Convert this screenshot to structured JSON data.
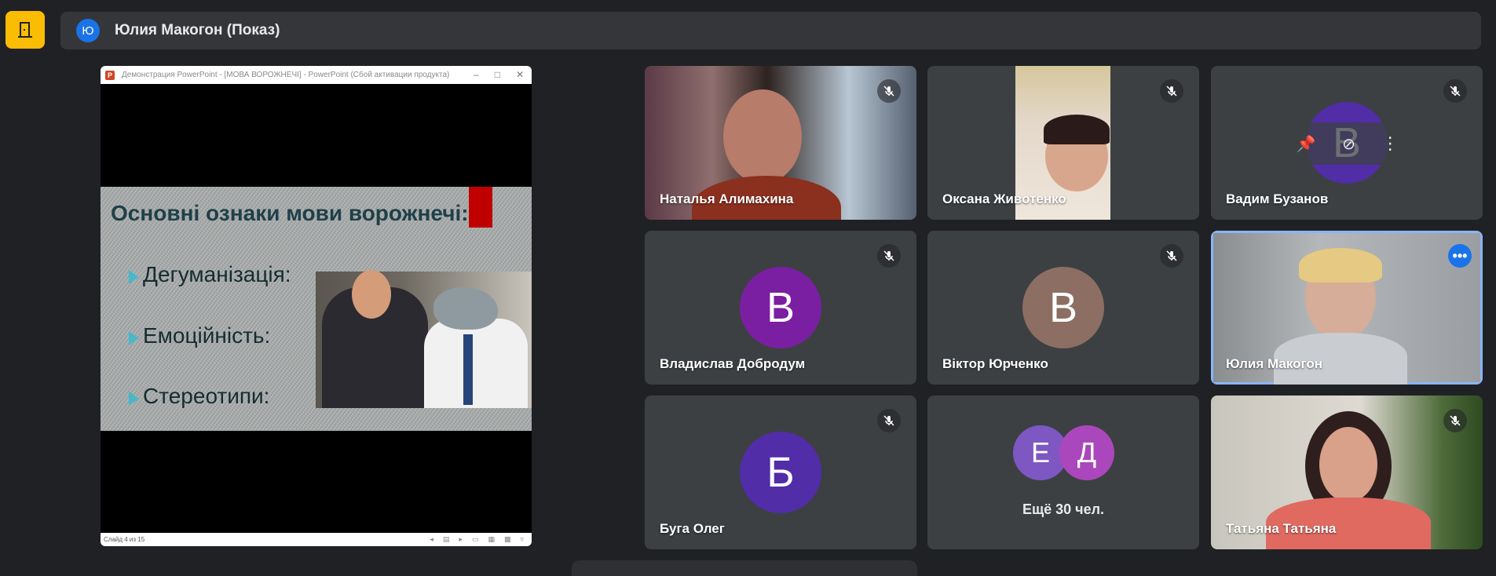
{
  "topbar": {
    "avatar_letter": "Ю",
    "title": "Юлия Макогон (Показ)"
  },
  "presentation": {
    "window_title": "Демонстрация PowerPoint - [МОВА ВОРОЖНЕЧІ] - PowerPoint (Сбой активации продукта)",
    "slide_title": "Основні ознаки мови ворожнечі:",
    "bullets": [
      "Дегуманізація:",
      "Емоційність:",
      "Стереотипи:"
    ],
    "status": "Слайд 4 из 15"
  },
  "participants": [
    {
      "name": "Наталья Алимахина",
      "type": "video",
      "muted": true
    },
    {
      "name": "Оксана Животенко",
      "type": "video",
      "muted": true
    },
    {
      "name": "Вадим Бузанов",
      "type": "avatar",
      "letter": "В",
      "muted": true
    },
    {
      "name": "Владислав Добродум",
      "type": "avatar",
      "letter": "В",
      "muted": true
    },
    {
      "name": "Віктор Юрченко",
      "type": "avatar",
      "letter": "В",
      "muted": true
    },
    {
      "name": "Юлия Макогон",
      "type": "video",
      "muted": false
    },
    {
      "name": "Буга Олег",
      "type": "avatar",
      "letter": "Б",
      "muted": true
    },
    {
      "name": "Ещё 30 чел.",
      "type": "group",
      "letters": [
        "Е",
        "Д"
      ]
    },
    {
      "name": "Татьяна Татьяна",
      "type": "video",
      "muted": true
    }
  ],
  "colors": {
    "background": "#202124",
    "tile": "#3c4043",
    "accent": "#1a73e8",
    "door_button": "#fbbc04",
    "avatar_purple": "#7b1fa2",
    "avatar_brown": "#8d6e63",
    "avatar_indigo": "#512da8",
    "avatar_violet": "#7e57c2",
    "avatar_magenta": "#ab47bc"
  }
}
